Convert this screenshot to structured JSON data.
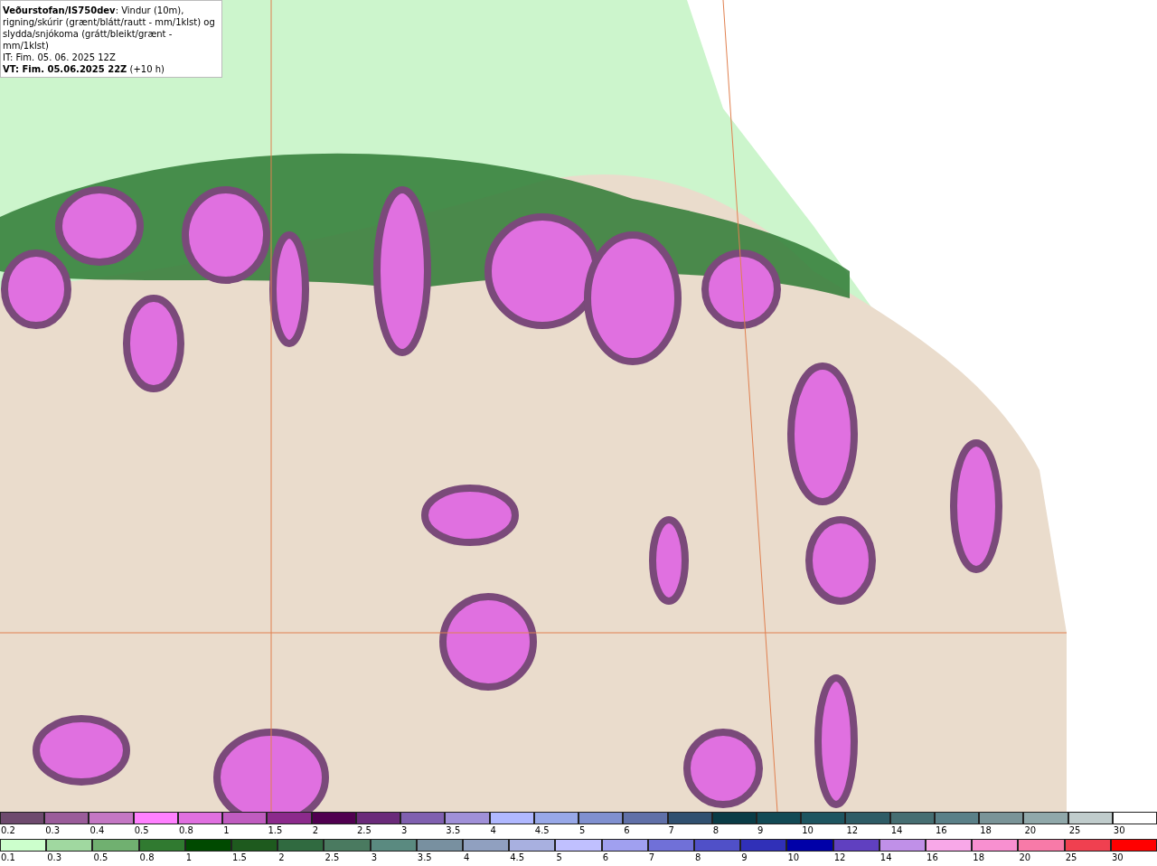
{
  "info_box": {
    "description": "**Veðurstofan/IS750dev**: Vindur (10m), rigning/skúrir (grænt/blátt/rautt - mm/1klst) og slydda/snjókoma (grátt/bleikt/grænt - mm/1klst)",
    "initial_time": "IT: Fim. 05. 06. 2025 12Z",
    "valid_time": "**VT: Fim. 05.06.2025 22Z** (+10 h)"
  },
  "legends": [
    {
      "items": [
        {
          "label": "0.2",
          "color": "#6e4a6e"
        },
        {
          "label": "0.3",
          "color": "#9a5c9a"
        },
        {
          "label": "0.4",
          "color": "#c477c4"
        },
        {
          "label": "0.5",
          "color": "#ff80ff"
        },
        {
          "label": "0.8",
          "color": "#e070e0"
        },
        {
          "label": "1",
          "color": "#c05cc0"
        },
        {
          "label": "1.5",
          "color": "#8c2a8c"
        },
        {
          "label": "2",
          "color": "#500050"
        },
        {
          "label": "2.5",
          "color": "#6a2a7a"
        },
        {
          "label": "3",
          "color": "#8060b0"
        },
        {
          "label": "3.5",
          "color": "#a090d8"
        },
        {
          "label": "4",
          "color": "#b0b8ff"
        },
        {
          "label": "4.5",
          "color": "#98a8e8"
        },
        {
          "label": "5",
          "color": "#8090d0"
        },
        {
          "label": "6",
          "color": "#6070a8"
        },
        {
          "label": "7",
          "color": "#305070"
        },
        {
          "label": "8",
          "color": "#0a3c46"
        },
        {
          "label": "9",
          "color": "#124a55"
        },
        {
          "label": "10",
          "color": "#1e5560"
        },
        {
          "label": "12",
          "color": "#2e5c66"
        },
        {
          "label": "14",
          "color": "#466e72"
        },
        {
          "label": "16",
          "color": "#5a8088"
        },
        {
          "label": "18",
          "color": "#7a9498"
        },
        {
          "label": "20",
          "color": "#90a8aa"
        },
        {
          "label": "25",
          "color": "#c0cccc"
        },
        {
          "label": "30",
          "color": "#ffffff"
        }
      ]
    },
    {
      "items": [
        {
          "label": "0.1",
          "color": "#ccffcc"
        },
        {
          "label": "0.3",
          "color": "#a0d8a0"
        },
        {
          "label": "0.5",
          "color": "#70b070"
        },
        {
          "label": "0.8",
          "color": "#307a30"
        },
        {
          "label": "1",
          "color": "#004a00"
        },
        {
          "label": "1.5",
          "color": "#1e5a1e"
        },
        {
          "label": "2",
          "color": "#306a40"
        },
        {
          "label": "2.5",
          "color": "#4a7a60"
        },
        {
          "label": "3",
          "color": "#5a8a80"
        },
        {
          "label": "3.5",
          "color": "#7890a0"
        },
        {
          "label": "4",
          "color": "#90a0c0"
        },
        {
          "label": "4.5",
          "color": "#a8b0e0"
        },
        {
          "label": "5",
          "color": "#c0c0ff"
        },
        {
          "label": "6",
          "color": "#a0a0f0"
        },
        {
          "label": "7",
          "color": "#7070d8"
        },
        {
          "label": "8",
          "color": "#5050c8"
        },
        {
          "label": "9",
          "color": "#3030b8"
        },
        {
          "label": "10",
          "color": "#0000a8"
        },
        {
          "label": "12",
          "color": "#6040c0"
        },
        {
          "label": "14",
          "color": "#c090e8"
        },
        {
          "label": "16",
          "color": "#f8a8e8"
        },
        {
          "label": "18",
          "color": "#f890d0"
        },
        {
          "label": "20",
          "color": "#f87aa8"
        },
        {
          "label": "25",
          "color": "#f04050"
        },
        {
          "label": "30",
          "color": "#ff0000"
        }
      ]
    }
  ]
}
